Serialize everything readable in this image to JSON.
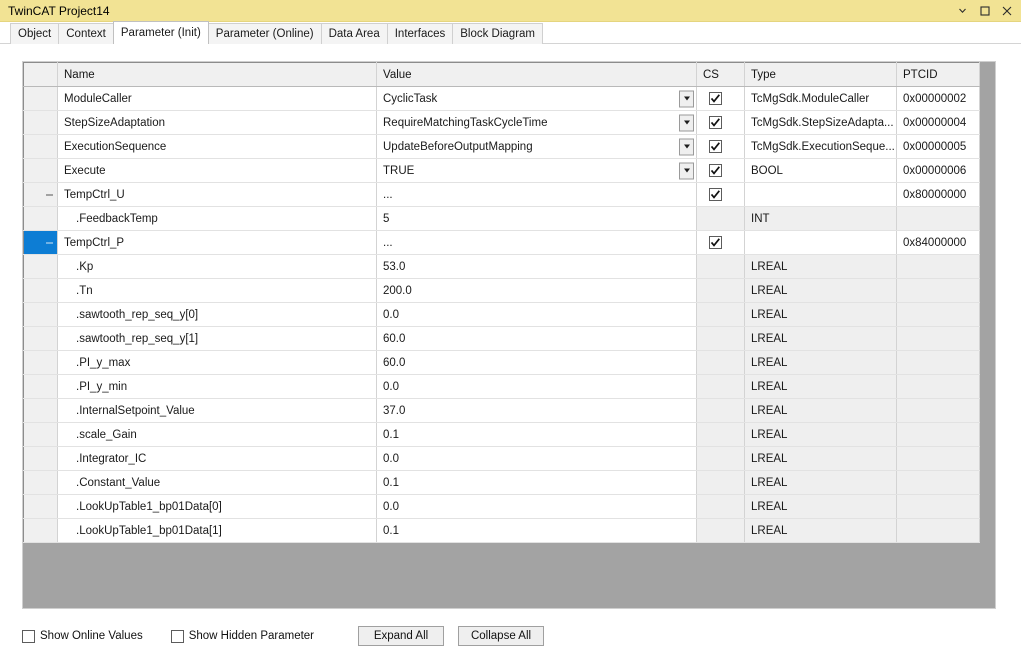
{
  "window": {
    "title": "TwinCAT Project14",
    "controls": [
      {
        "name": "window-menu-chevron",
        "glyph": "chevron-down-icon"
      },
      {
        "name": "maximize-restore",
        "glyph": "square-icon"
      },
      {
        "name": "close",
        "glyph": "close-icon"
      }
    ],
    "titlebar_color": "#f2e394"
  },
  "tabs": [
    {
      "label": "Object",
      "active": false
    },
    {
      "label": "Context",
      "active": false
    },
    {
      "label": "Parameter (Init)",
      "active": true
    },
    {
      "label": "Parameter (Online)",
      "active": false
    },
    {
      "label": "Data Area",
      "active": false
    },
    {
      "label": "Interfaces",
      "active": false
    },
    {
      "label": "Block Diagram",
      "active": false
    }
  ],
  "grid": {
    "columns": [
      "",
      "Name",
      "Value",
      "CS",
      "Type",
      "PTCID"
    ],
    "selection_color": "#0d7dd4",
    "rows": [
      {
        "expander": "",
        "selected": false,
        "indent": false,
        "name": "ModuleCaller",
        "value": "CyclicTask",
        "dropdown": true,
        "cs": true,
        "type": "TcMgSdk.ModuleCaller",
        "ptcid": "0x00000002",
        "greyed": false
      },
      {
        "expander": "",
        "selected": false,
        "indent": false,
        "name": "StepSizeAdaptation",
        "value": "RequireMatchingTaskCycleTime",
        "dropdown": true,
        "cs": true,
        "type": "TcMgSdk.StepSizeAdapta...",
        "ptcid": "0x00000004",
        "greyed": false
      },
      {
        "expander": "",
        "selected": false,
        "indent": false,
        "name": "ExecutionSequence",
        "value": "UpdateBeforeOutputMapping",
        "dropdown": true,
        "cs": true,
        "type": "TcMgSdk.ExecutionSeque...",
        "ptcid": "0x00000005",
        "greyed": false
      },
      {
        "expander": "",
        "selected": false,
        "indent": false,
        "name": "Execute",
        "value": "TRUE",
        "dropdown": true,
        "cs": true,
        "type": "BOOL",
        "ptcid": "0x00000006",
        "greyed": false
      },
      {
        "expander": "-",
        "selected": false,
        "indent": false,
        "name": "TempCtrl_U",
        "value": "...",
        "dropdown": false,
        "cs": true,
        "type": "",
        "ptcid": "0x80000000",
        "greyed": false
      },
      {
        "expander": "",
        "selected": false,
        "indent": true,
        "name": ".FeedbackTemp",
        "value": "5",
        "dropdown": false,
        "cs": null,
        "type": "INT",
        "ptcid": "",
        "greyed": true
      },
      {
        "expander": "-",
        "selected": true,
        "indent": false,
        "name": "TempCtrl_P",
        "value": "...",
        "dropdown": false,
        "cs": true,
        "type": "",
        "ptcid": "0x84000000",
        "greyed": false
      },
      {
        "expander": "",
        "selected": false,
        "indent": true,
        "name": ".Kp",
        "value": "53.0",
        "dropdown": false,
        "cs": null,
        "type": "LREAL",
        "ptcid": "",
        "greyed": true
      },
      {
        "expander": "",
        "selected": false,
        "indent": true,
        "name": ".Tn",
        "value": "200.0",
        "dropdown": false,
        "cs": null,
        "type": "LREAL",
        "ptcid": "",
        "greyed": true
      },
      {
        "expander": "",
        "selected": false,
        "indent": true,
        "name": ".sawtooth_rep_seq_y[0]",
        "value": "0.0",
        "dropdown": false,
        "cs": null,
        "type": "LREAL",
        "ptcid": "",
        "greyed": true
      },
      {
        "expander": "",
        "selected": false,
        "indent": true,
        "name": ".sawtooth_rep_seq_y[1]",
        "value": "60.0",
        "dropdown": false,
        "cs": null,
        "type": "LREAL",
        "ptcid": "",
        "greyed": true
      },
      {
        "expander": "",
        "selected": false,
        "indent": true,
        "name": ".PI_y_max",
        "value": "60.0",
        "dropdown": false,
        "cs": null,
        "type": "LREAL",
        "ptcid": "",
        "greyed": true
      },
      {
        "expander": "",
        "selected": false,
        "indent": true,
        "name": ".PI_y_min",
        "value": "0.0",
        "dropdown": false,
        "cs": null,
        "type": "LREAL",
        "ptcid": "",
        "greyed": true
      },
      {
        "expander": "",
        "selected": false,
        "indent": true,
        "name": ".InternalSetpoint_Value",
        "value": "37.0",
        "dropdown": false,
        "cs": null,
        "type": "LREAL",
        "ptcid": "",
        "greyed": true
      },
      {
        "expander": "",
        "selected": false,
        "indent": true,
        "name": ".scale_Gain",
        "value": "0.1",
        "dropdown": false,
        "cs": null,
        "type": "LREAL",
        "ptcid": "",
        "greyed": true
      },
      {
        "expander": "",
        "selected": false,
        "indent": true,
        "name": ".Integrator_IC",
        "value": "0.0",
        "dropdown": false,
        "cs": null,
        "type": "LREAL",
        "ptcid": "",
        "greyed": true
      },
      {
        "expander": "",
        "selected": false,
        "indent": true,
        "name": ".Constant_Value",
        "value": "0.1",
        "dropdown": false,
        "cs": null,
        "type": "LREAL",
        "ptcid": "",
        "greyed": true
      },
      {
        "expander": "",
        "selected": false,
        "indent": true,
        "name": ".LookUpTable1_bp01Data[0]",
        "value": "0.0",
        "dropdown": false,
        "cs": null,
        "type": "LREAL",
        "ptcid": "",
        "greyed": true
      },
      {
        "expander": "",
        "selected": false,
        "indent": true,
        "name": ".LookUpTable1_bp01Data[1]",
        "value": "0.1",
        "dropdown": false,
        "cs": null,
        "type": "LREAL",
        "ptcid": "",
        "greyed": true
      }
    ]
  },
  "bottom": {
    "show_online_values": {
      "label": "Show Online Values",
      "checked": false
    },
    "show_hidden_parameter": {
      "label": "Show Hidden Parameter",
      "checked": false
    },
    "expand_all": "Expand All",
    "collapse_all": "Collapse All"
  }
}
